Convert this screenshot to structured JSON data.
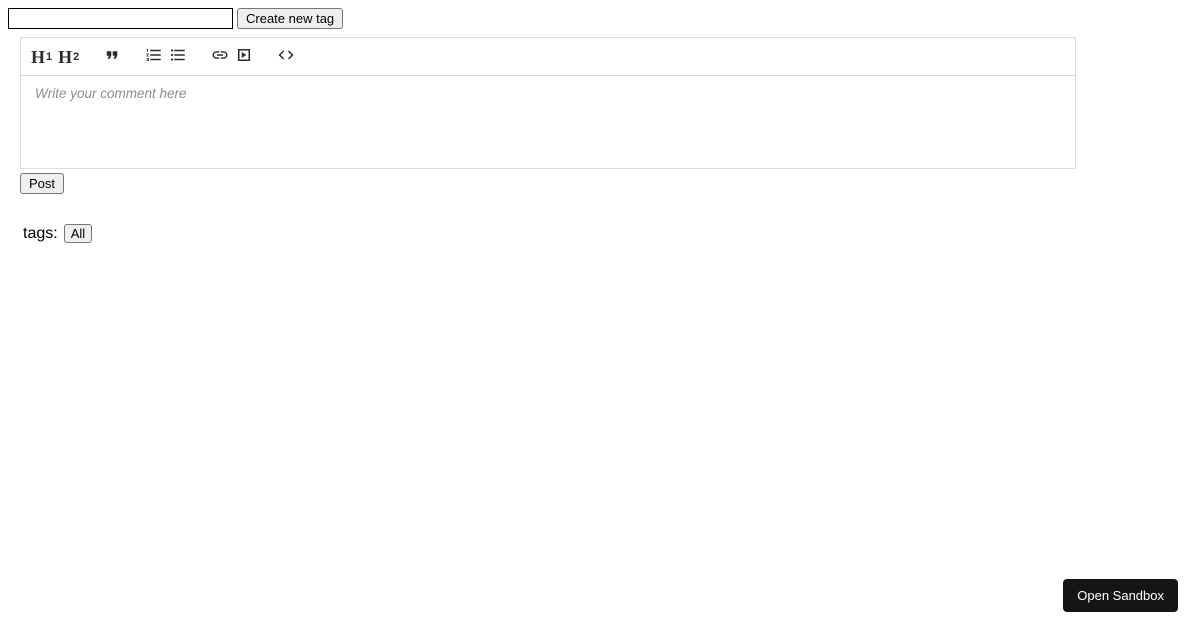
{
  "topbar": {
    "tag_input_value": "",
    "create_tag_label": "Create new tag"
  },
  "toolbar": {
    "h1_label": "H",
    "h1_sub": "1",
    "h2_label": "H",
    "h2_sub": "2"
  },
  "editor": {
    "placeholder": "Write your comment here"
  },
  "actions": {
    "post_label": "Post"
  },
  "tags": {
    "label": "tags:",
    "all_button": "All"
  },
  "sandbox": {
    "open_label": "Open Sandbox"
  }
}
